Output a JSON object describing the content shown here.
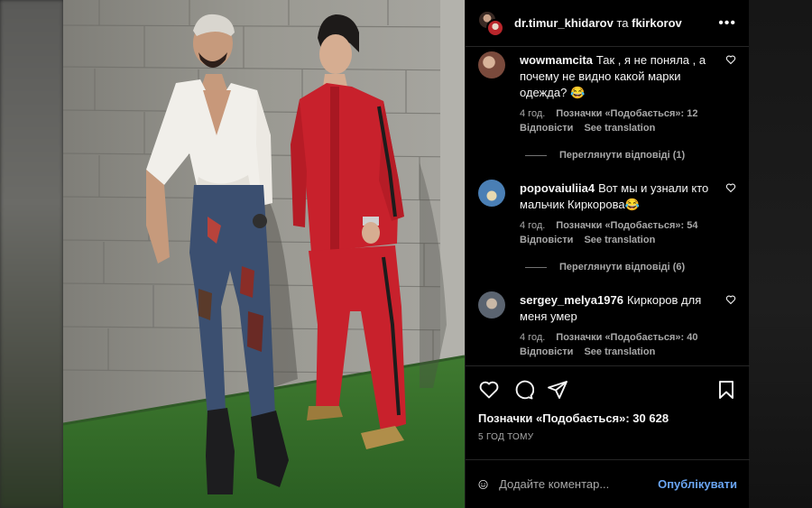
{
  "post": {
    "author": "dr.timur_khidarov",
    "connector": "та",
    "coauthor": "fkirkorov",
    "more_icon": "more-horizontal-icon"
  },
  "comments": [
    {
      "username": "wowmamcita",
      "text": "Так , я не поняла , а почему не видно какой марки одежда? 😂",
      "time": "4 год.",
      "likes": "Позначки «Подобається»: 12",
      "reply": "Відповісти",
      "translate": "See translation",
      "view_replies": "Переглянути відповіді (1)",
      "avatar_color": "#7a4a3c"
    },
    {
      "username": "popovaiuliia4",
      "text": "Вот мы и узнали кто мальчик Киркорова😂",
      "time": "4 год.",
      "likes": "Позначки «Подобається»: 54",
      "reply": "Відповісти",
      "translate": "See translation",
      "view_replies": "Переглянути відповіді (6)",
      "avatar_color": "#4a7fb5"
    },
    {
      "username": "sergey_melya1976",
      "text": "Киркоров для меня умер",
      "time": "4 год.",
      "likes": "Позначки «Подобається»: 40",
      "reply": "Відповісти",
      "translate": "See translation",
      "avatar_color": "#5b6470"
    }
  ],
  "actions": {
    "likes": "Позначки «Подобається»: 30 628",
    "time_ago": "5 ГОД ТОМУ",
    "icons": [
      "heart-icon",
      "comment-icon",
      "share-icon",
      "bookmark-icon"
    ]
  },
  "add_comment": {
    "placeholder": "Додайте коментар...",
    "publish": "Опублікувати"
  },
  "colors": {
    "accent": "#6aa5f3",
    "panel_bg": "#000000",
    "secondary_text": "#a8a8a8"
  }
}
